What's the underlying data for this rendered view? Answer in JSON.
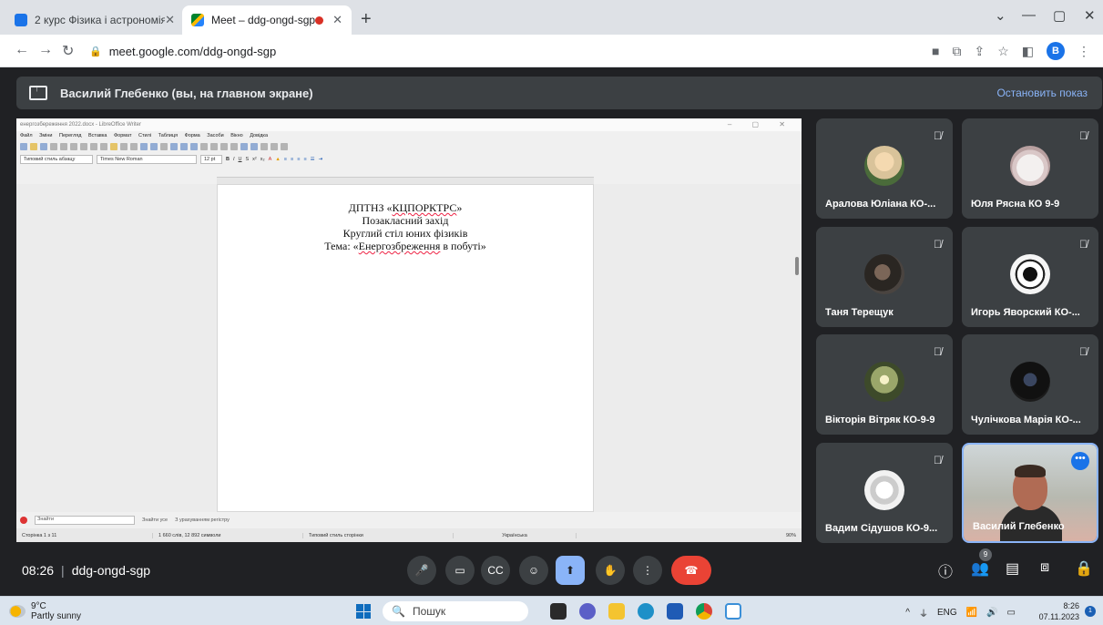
{
  "browser": {
    "tabs": [
      {
        "title": "2 курс Фізика і астрономія",
        "close": "✕"
      },
      {
        "title": "Meet – ddg-ongd-sgp",
        "close": "✕"
      }
    ],
    "new_tab": "+",
    "url": "meet.google.com/ddg-ongd-sgp",
    "profile_initial": "В"
  },
  "presentation": {
    "banner_text": "Василий Глебенко (вы, на главном экране)",
    "stop_label": "Остановить показ"
  },
  "writer": {
    "title": "енергозбереження 2022.docx - LibreOffice Writer",
    "menu": [
      "Файл",
      "Зміни",
      "Перегляд",
      "Вставка",
      "Формат",
      "Стилі",
      "Таблиця",
      "Форма",
      "Засоби",
      "Вікно",
      "Довідка"
    ],
    "para_style": "Типовий стиль абзацу",
    "font_name": "Times New Roman",
    "font_size": "12 pt",
    "doc_lines": [
      "ДПТНЗ «КЦПОРКТРС»",
      "Позакласний захід",
      "Круглий стіл юних фізиків",
      "Тема: «Енергозбреження в побуті»"
    ],
    "find_placeholder": "Знайти",
    "find_all": "Знайти усе",
    "match_case": "З урахуванням регістру",
    "status": {
      "page": "Сторінка 1 з 11",
      "words": "1 660 слів, 12 892 символи",
      "page_style": "Типовий стиль сторінки",
      "language": "Українська",
      "zoom": "90%"
    }
  },
  "participants": [
    {
      "name": "Аралова Юліана КО-..."
    },
    {
      "name": "Юля Рясна КО 9-9"
    },
    {
      "name": "Таня Терещук"
    },
    {
      "name": "Игорь Яворский КО-..."
    },
    {
      "name": "Вікторія Вітряк КО-9-9"
    },
    {
      "name": "Чулічкова Марія КО-..."
    },
    {
      "name": "Вадим Сідушов КО-9..."
    },
    {
      "name": "Василий Глебенко"
    }
  ],
  "meeting": {
    "time": "08:26",
    "code": "ddg-ongd-sgp",
    "people_count": "9"
  },
  "taskbar": {
    "temp": "9°C",
    "weather": "Partly sunny",
    "search": "Пошук",
    "lang": "ENG",
    "time": "8:26",
    "date": "07.11.2023",
    "notifications": "1"
  }
}
